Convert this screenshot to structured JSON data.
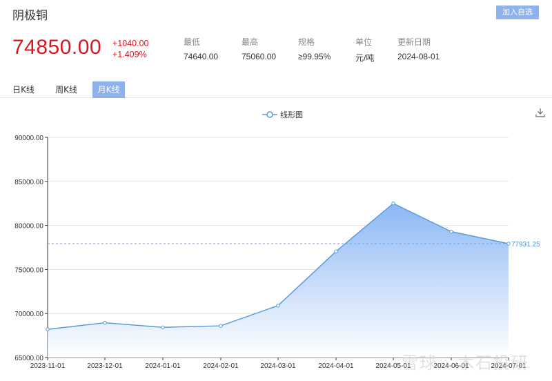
{
  "header": {
    "title": "阴极铜",
    "add_button": "加入自选"
  },
  "quote": {
    "price": "74850.00",
    "change": "+1040.00",
    "change_pct": "+1.409%",
    "stats": [
      {
        "label": "最低",
        "value": "74640.00"
      },
      {
        "label": "最高",
        "value": "75060.00"
      },
      {
        "label": "规格",
        "value": "≥99.95%"
      },
      {
        "label": "单位",
        "value": "元/吨"
      },
      {
        "label": "更新日期",
        "value": "2024-08-01"
      }
    ]
  },
  "tabs": [
    {
      "label": "日K线",
      "active": false
    },
    {
      "label": "周K线",
      "active": false
    },
    {
      "label": "月K线",
      "active": true
    }
  ],
  "colors": {
    "accent": "#8fb2ea",
    "up": "#d6171d",
    "line": "#5b9bd8",
    "mark_line": "#6aa6e2"
  },
  "icons": {
    "download": "download-icon",
    "legend": "line-legend-icon"
  },
  "watermark": "雪球 · 木石投研",
  "chart_data": {
    "type": "area",
    "series": [
      {
        "name": "线形图",
        "x": [
          "2023-11-01",
          "2023-12-01",
          "2024-01-01",
          "2024-02-01",
          "2024-03-01",
          "2024-04-01",
          "2024-05-01",
          "2024-06-01",
          "2024-07-01"
        ],
        "values": [
          68200,
          68950,
          68430,
          68600,
          70900,
          77050,
          82500,
          79300,
          77931.25
        ]
      }
    ],
    "x_ticks": [
      "2023-11-01",
      "2023-12-01",
      "2024-01-01",
      "2024-02-01",
      "2024-03-01",
      "2024-04-01",
      "2024-05-01",
      "2024-06-01",
      "2024-07-01"
    ],
    "y_ticks": [
      "90000.00",
      "85000.00",
      "80000.00",
      "75000.00",
      "70000.00",
      "65000.00"
    ],
    "ylim": [
      65000,
      90000
    ],
    "mark_line": {
      "value": 77931.25,
      "label": "77931.25"
    },
    "grid": true,
    "legend": "top-center"
  }
}
